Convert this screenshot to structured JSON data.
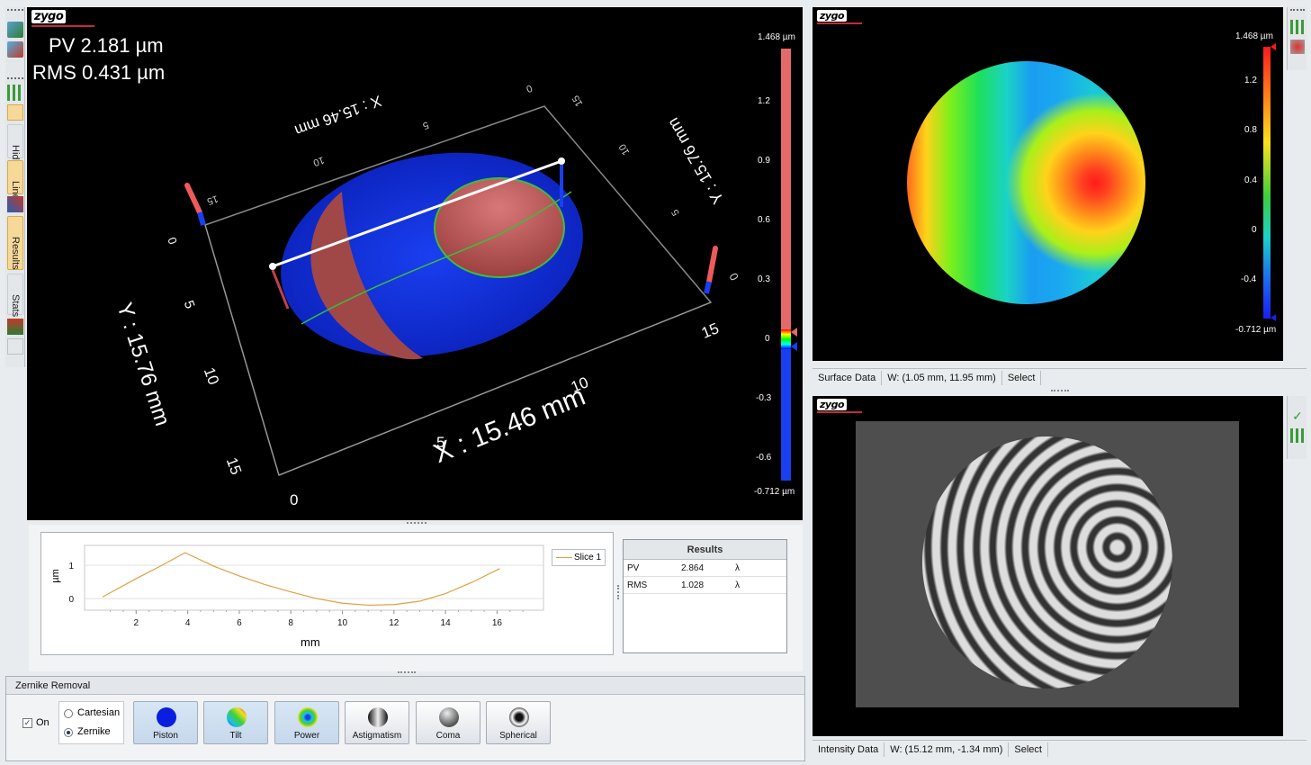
{
  "left_toolbar": {
    "tabs": [
      {
        "label": "Hide"
      },
      {
        "label": "Linear"
      },
      {
        "label": "Results"
      },
      {
        "label": "Stats"
      }
    ]
  },
  "view3d": {
    "logo": "zygo",
    "pv": "PV 2.181 µm",
    "rms": "RMS 0.431 µm",
    "x_axis_label": "X : 15.46 mm",
    "y_axis_label": "Y : 15.76 mm",
    "x_axis_label_far": "X : 15.46 mm",
    "y_axis_label_far": "Y : 15.76 mm",
    "front_ticks": [
      "0",
      "5",
      "10",
      "15"
    ],
    "left_ticks": [
      "0",
      "5",
      "10",
      "15"
    ],
    "back_ticks_top": [
      "0",
      "5",
      "10",
      "15"
    ],
    "right_ticks": [
      "0",
      "5",
      "10",
      "15"
    ],
    "colorbar": {
      "max": "1.468 µm",
      "min": "-0.712 µm",
      "ticks": [
        "1.2",
        "0.9",
        "0.6",
        "0.3",
        "0",
        "-0.3",
        "-0.6"
      ]
    }
  },
  "surface_panel": {
    "logo": "zygo",
    "colorbar": {
      "max": "1.468 µm",
      "min": "-0.712 µm",
      "ticks": [
        "1.2",
        "0.8",
        "0.4",
        "0",
        "-0.4"
      ]
    },
    "status": [
      "Surface Data",
      "W: (1.05 mm, 11.95 mm)",
      "Select"
    ]
  },
  "intensity_panel": {
    "logo": "zygo",
    "status": [
      "Intensity Data",
      "W: (15.12 mm, -1.34 mm)",
      "Select"
    ]
  },
  "slice_chart": {
    "legend": "Slice 1",
    "ylabel": "µm",
    "xlabel": "mm",
    "x_ticks": [
      "2",
      "4",
      "6",
      "8",
      "10",
      "12",
      "14",
      "16"
    ],
    "y_ticks": [
      "1",
      "0"
    ],
    "color": "#e0a040"
  },
  "chart_data": {
    "type": "line",
    "xlabel": "mm",
    "ylabel": "µm",
    "xlim": [
      0,
      17.8
    ],
    "ylim": [
      -0.35,
      1.6
    ],
    "series": [
      {
        "name": "Slice 1",
        "x": [
          0.7,
          2,
          3,
          3.9,
          5,
          6,
          7,
          8,
          9,
          10,
          11,
          12,
          13,
          14,
          15,
          16.1
        ],
        "y": [
          0.05,
          0.6,
          1.0,
          1.38,
          0.98,
          0.68,
          0.42,
          0.2,
          0.0,
          -0.14,
          -0.2,
          -0.18,
          -0.08,
          0.15,
          0.48,
          0.9
        ]
      }
    ]
  },
  "results": {
    "title": "Results",
    "rows": [
      {
        "name": "PV",
        "value": "2.864",
        "unit": "λ"
      },
      {
        "name": "RMS",
        "value": "1.028",
        "unit": "λ"
      }
    ]
  },
  "zernike": {
    "title": "Zernike Removal",
    "on_label": "On",
    "on_checked": true,
    "radio": [
      "Cartesian",
      "Zernike"
    ],
    "radio_selected": "Zernike",
    "buttons": [
      "Piston",
      "Tilt",
      "Power",
      "Astigmatism",
      "Coma",
      "Spherical"
    ]
  }
}
